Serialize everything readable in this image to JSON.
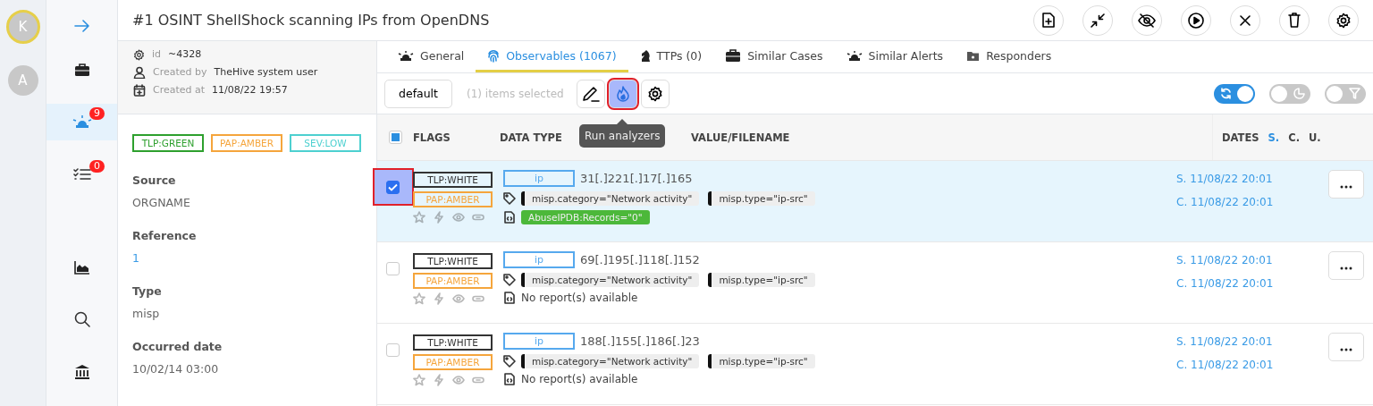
{
  "avatars": [
    {
      "letter": "K",
      "selected": true
    },
    {
      "letter": "A",
      "selected": false
    }
  ],
  "nav": [
    {
      "kind": "expand",
      "selected": false
    },
    {
      "kind": "cases",
      "selected": false
    },
    {
      "kind": "alerts",
      "badge": "9",
      "selected": true
    },
    {
      "kind": "tasks",
      "badge": "0",
      "selected": false
    },
    {
      "kind": "dashboards",
      "selected": false
    },
    {
      "kind": "search",
      "selected": false
    },
    {
      "kind": "organisation",
      "selected": false
    }
  ],
  "header": {
    "title": "#1 OSINT ShellShock scanning IPs from OpenDNS",
    "actions": [
      {
        "kind": "new-file"
      },
      {
        "kind": "collapse"
      },
      {
        "kind": "hide"
      },
      {
        "kind": "run"
      },
      {
        "kind": "close"
      },
      {
        "kind": "delete"
      },
      {
        "kind": "settings"
      }
    ]
  },
  "details": {
    "id_label": "id",
    "id": "~4328",
    "created_by_label": "Created by",
    "created_by": "TheHive system user",
    "created_at_label": "Created at",
    "created_at": "11/08/22 19:57",
    "tags": [
      {
        "text": "TLP:GREEN",
        "color": "#2ea02e"
      },
      {
        "text": "PAP:AMBER",
        "color": "#f5a53c"
      },
      {
        "text": "SEV:LOW",
        "color": "#4dd0d0"
      }
    ],
    "fields": [
      {
        "label": "Source",
        "value": "ORGNAME",
        "kind": "text"
      },
      {
        "label": "Reference",
        "value": "1",
        "kind": "link"
      },
      {
        "label": "Type",
        "value": "misp",
        "kind": "text"
      },
      {
        "label": "Occurred date",
        "value": "10/02/14 03:00",
        "kind": "text"
      }
    ]
  },
  "tabs": [
    {
      "label": "General",
      "kind": "alert",
      "selected": false
    },
    {
      "label": "Observables (1067)",
      "kind": "fingerprint",
      "selected": true
    },
    {
      "label": "TTPs (0)",
      "kind": "chess",
      "selected": false
    },
    {
      "label": "Similar Cases",
      "kind": "cases",
      "selected": false
    },
    {
      "label": "Similar Alerts",
      "kind": "alert",
      "selected": false
    },
    {
      "label": "Responders",
      "kind": "folder",
      "selected": false
    }
  ],
  "toolbar": {
    "filter": "default",
    "selection": "(1) items selected",
    "buttons": [
      {
        "kind": "edit",
        "highlighted": false
      },
      {
        "kind": "analyze",
        "highlighted": true
      }
    ],
    "settings": {
      "kind": "settings",
      "highlighted": false
    },
    "tooltip": "Run analyzers",
    "toggles": [
      {
        "kind": "refresh",
        "on": true
      },
      {
        "kind": "stats",
        "on": false
      },
      {
        "kind": "filter",
        "on": false
      }
    ]
  },
  "table": {
    "select_all": {
      "kind": "partial"
    },
    "columns": [
      "FLAGS",
      "DATA TYPE",
      "VALUE/FILENAME",
      "DATES"
    ],
    "date_sorts": [
      {
        "label": "S.",
        "selected": true
      },
      {
        "label": "C.",
        "selected": false
      },
      {
        "label": "U.",
        "selected": false
      }
    ],
    "rows": [
      {
        "selected": true,
        "highlighted": true,
        "tlp": "TLP:WHITE",
        "pap": "PAP:AMBER",
        "data_type": "ip",
        "value": "31[.]221[.]17[.]165",
        "tags": [
          "misp.category=\"Network activity\"",
          "misp.type=\"ip-src\""
        ],
        "report": {
          "kind": "badge",
          "text": "AbuseIPDB:Records=\"0\""
        },
        "dates": [
          "S. 11/08/22 20:01",
          "C. 11/08/22 20:01"
        ]
      },
      {
        "selected": false,
        "highlighted": false,
        "tlp": "TLP:WHITE",
        "pap": "PAP:AMBER",
        "data_type": "ip",
        "value": "69[.]195[.]118[.]152",
        "tags": [
          "misp.category=\"Network activity\"",
          "misp.type=\"ip-src\""
        ],
        "report": {
          "kind": "text",
          "text": "No report(s) available"
        },
        "dates": [
          "S. 11/08/22 20:01",
          "C. 11/08/22 20:01"
        ]
      },
      {
        "selected": false,
        "highlighted": false,
        "tlp": "TLP:WHITE",
        "pap": "PAP:AMBER",
        "data_type": "ip",
        "value": "188[.]155[.]186[.]23",
        "tags": [
          "misp.category=\"Network activity\"",
          "misp.type=\"ip-src\""
        ],
        "report": {
          "kind": "text",
          "text": "No report(s) available"
        },
        "dates": [
          "S. 11/08/22 20:01",
          "C. 11/08/22 20:01"
        ]
      }
    ]
  }
}
